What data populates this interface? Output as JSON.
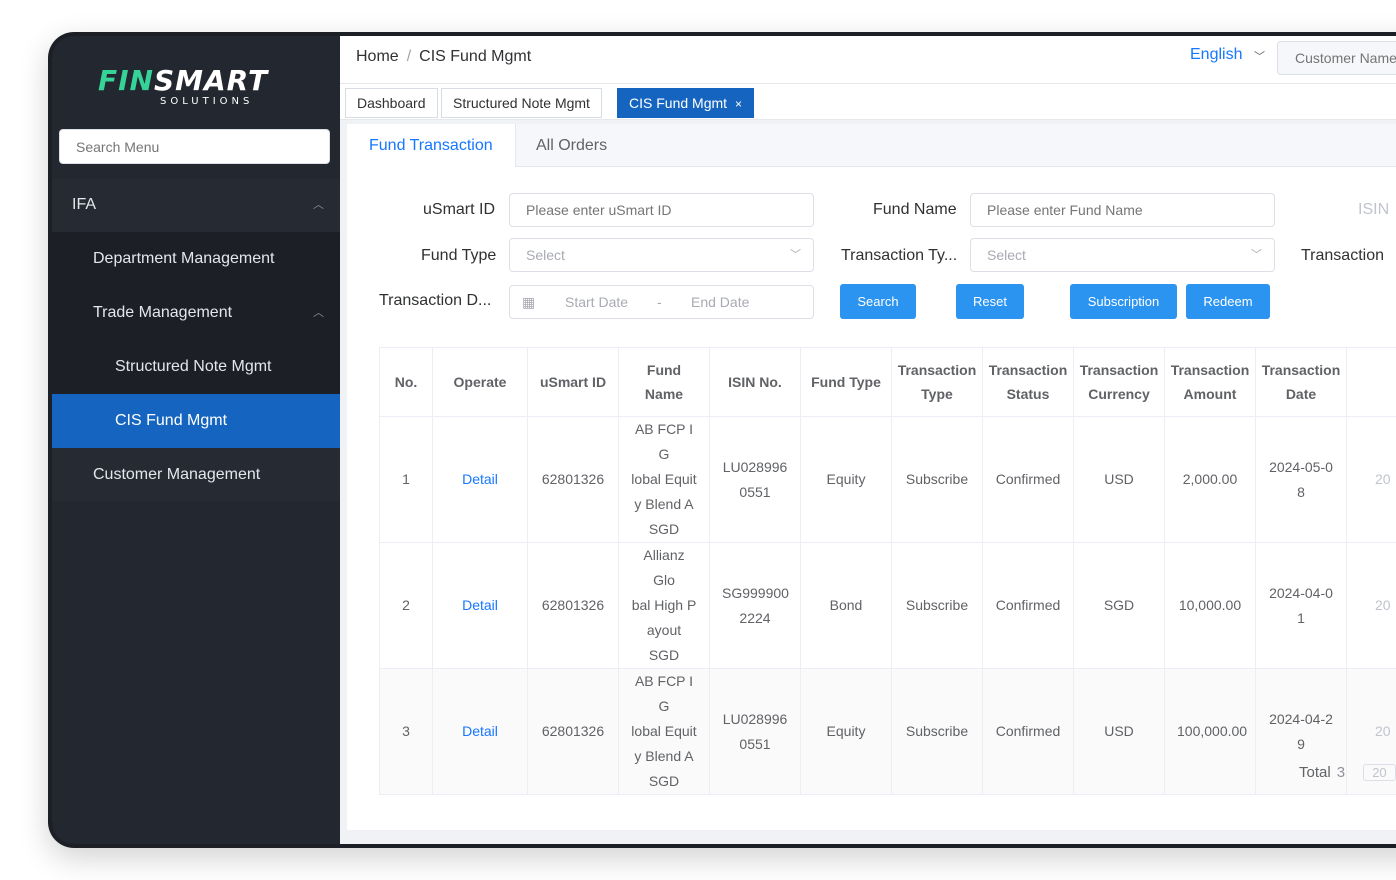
{
  "brand": {
    "logo_part1": "FIN",
    "logo_part2": "SMART",
    "logo_sub": "SOLUTIONS"
  },
  "sidebar": {
    "search_placeholder": "Search Menu",
    "items": [
      {
        "label": "IFA",
        "level": 1,
        "chevron": "up"
      },
      {
        "label": "Department Management",
        "level": 2
      },
      {
        "label": "Trade Management",
        "level": 2,
        "chevron": "up"
      },
      {
        "label": "Structured Note Mgmt",
        "level": 3
      },
      {
        "label": "CIS Fund Mgmt",
        "level": 3,
        "active": true
      },
      {
        "label": "Customer Management",
        "level": 2
      }
    ]
  },
  "header": {
    "breadcrumb": [
      "Home",
      "CIS Fund Mgmt"
    ],
    "breadcrumb_sep": "/",
    "language": "English",
    "customer_placeholder": "Customer Name"
  },
  "tabs": [
    {
      "label": "Dashboard"
    },
    {
      "label": "Structured Note Mgmt"
    },
    {
      "label": "CIS Fund Mgmt",
      "active": true,
      "close": "×"
    }
  ],
  "subtabs": [
    {
      "label": "Fund Transaction",
      "active": true
    },
    {
      "label": "All Orders"
    }
  ],
  "filters": {
    "usmart_id_label": "uSmart ID",
    "usmart_id_placeholder": "Please enter uSmart ID",
    "fund_name_label": "Fund Name",
    "fund_name_placeholder": "Please enter Fund Name",
    "isin_label": "ISIN",
    "fund_type_label": "Fund Type",
    "fund_type_placeholder": "Select",
    "transaction_type_label": "Transaction Ty...",
    "transaction_type_placeholder": "Select",
    "transaction_status_label": "Transaction",
    "transaction_date_label": "Transaction D...",
    "start_date_placeholder": "Start Date",
    "date_sep": "-",
    "end_date_placeholder": "End Date"
  },
  "buttons": {
    "search": "Search",
    "reset": "Reset",
    "subscription": "Subscription",
    "redeem": "Redeem"
  },
  "table": {
    "columns": [
      [
        "No."
      ],
      [
        "Operate"
      ],
      [
        "uSmart ID"
      ],
      [
        "Fund",
        "Name"
      ],
      [
        "ISIN No."
      ],
      [
        "Fund Type"
      ],
      [
        "Transaction",
        "Type"
      ],
      [
        "Transaction",
        "Status"
      ],
      [
        "Transaction",
        "Currency"
      ],
      [
        "Transaction",
        "Amount"
      ],
      [
        "Transaction",
        "Date"
      ]
    ],
    "rows": [
      {
        "no": "1",
        "operate": "Detail",
        "usmart_id": "62801326",
        "fund_name": [
          "AB FCP I G",
          "lobal Equit",
          "y Blend A",
          "SGD"
        ],
        "isin": [
          "LU028996",
          "0551"
        ],
        "fund_type": "Equity",
        "tx_type": "Subscribe",
        "tx_status": "Confirmed",
        "currency": "USD",
        "amount": "2,000.00",
        "date": [
          "2024-05-0",
          "8"
        ],
        "extra": "20"
      },
      {
        "no": "2",
        "operate": "Detail",
        "usmart_id": "62801326",
        "fund_name": [
          "Allianz Glo",
          "bal High P",
          "ayout SGD"
        ],
        "isin": [
          "SG999900",
          "2224"
        ],
        "fund_type": "Bond",
        "tx_type": "Subscribe",
        "tx_status": "Confirmed",
        "currency": "SGD",
        "amount": "10,000.00",
        "date": [
          "2024-04-0",
          "1"
        ],
        "extra": "20"
      },
      {
        "no": "3",
        "operate": "Detail",
        "usmart_id": "62801326",
        "fund_name": [
          "AB FCP I G",
          "lobal Equit",
          "y Blend A",
          "SGD"
        ],
        "isin": [
          "LU028996",
          "0551"
        ],
        "fund_type": "Equity",
        "tx_type": "Subscribe",
        "tx_status": "Confirmed",
        "currency": "USD",
        "amount": "100,000.00",
        "date": [
          "2024-04-2",
          "9"
        ],
        "extra": "20"
      }
    ]
  },
  "pagination": {
    "total_label": "Total",
    "total_count": "3",
    "page_size": "20"
  },
  "colors": {
    "accent": "#1565c0",
    "link": "#1677ff",
    "button": "#2b94f0",
    "sidebar_bg": "#1c1f26",
    "brand_green": "#36d399"
  }
}
